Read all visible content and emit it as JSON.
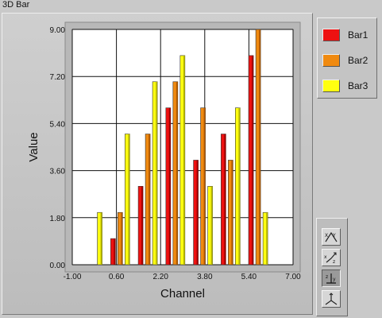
{
  "window": {
    "title": "3D Bar"
  },
  "legend": [
    {
      "name": "Bar1",
      "color": "#ee1111"
    },
    {
      "name": "Bar2",
      "color": "#f08a10"
    },
    {
      "name": "Bar3",
      "color": "#ffff10"
    }
  ],
  "tools": [
    {
      "name": "pan-xy-icon",
      "label": "XY"
    },
    {
      "name": "rotate-xyz-icon",
      "label": "XYZ"
    },
    {
      "name": "zoom-z-icon",
      "label": "Z"
    },
    {
      "name": "axes-reset-icon",
      "label": ""
    }
  ],
  "colors": {
    "plot_bg": "#ffffff",
    "grid": "#111111",
    "frame": "#b8b8b8"
  },
  "chart_data": {
    "type": "bar",
    "title": "",
    "xlabel": "Channel",
    "ylabel": "Value",
    "xlim": [
      -1.0,
      7.0
    ],
    "ylim": [
      0.0,
      9.0
    ],
    "xticks": [
      "-1.00",
      "0.60",
      "2.20",
      "3.80",
      "5.40",
      "7.00"
    ],
    "yticks": [
      "0.00",
      "1.80",
      "3.60",
      "5.40",
      "7.20",
      "9.00"
    ],
    "categories": [
      0,
      1,
      2,
      3,
      4,
      5,
      6
    ],
    "series": [
      {
        "name": "Bar1",
        "values": [
          0,
          1,
          3,
          6,
          4,
          5,
          8
        ]
      },
      {
        "name": "Bar2",
        "values": [
          0,
          2,
          5,
          7,
          6,
          4,
          9
        ]
      },
      {
        "name": "Bar3",
        "values": [
          2,
          5,
          7,
          8,
          3,
          6,
          2
        ]
      }
    ],
    "grid": true,
    "legend_position": "right"
  }
}
